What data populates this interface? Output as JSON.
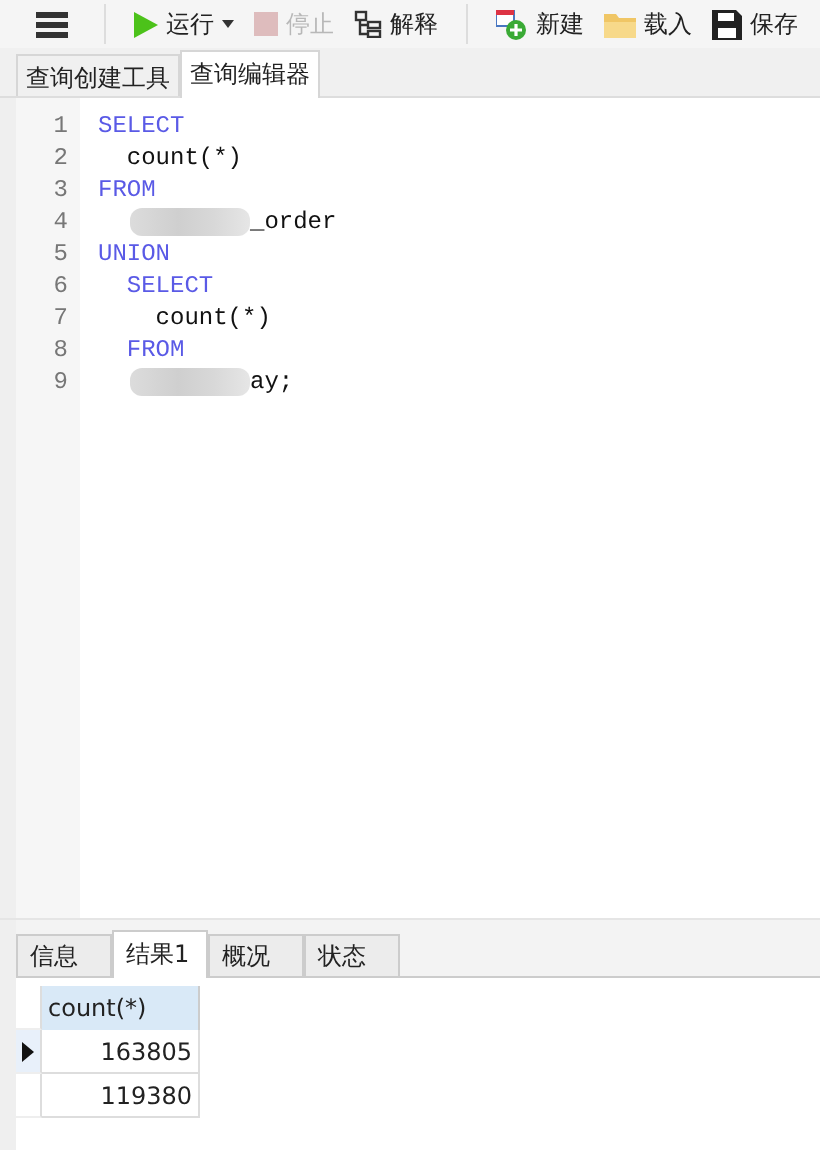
{
  "toolbar": [
    {
      "kind": "menu"
    },
    {
      "kind": "run",
      "label": "运行",
      "disabled": false
    },
    {
      "kind": "stop",
      "label": "停止",
      "disabled": true
    },
    {
      "kind": "explain",
      "label": "解释",
      "disabled": false
    },
    {
      "kind": "new",
      "label": "新建",
      "disabled": false
    },
    {
      "kind": "load",
      "label": "载入",
      "disabled": false
    },
    {
      "kind": "save",
      "label": "保存",
      "disabled": false
    }
  ],
  "editor_tabs": [
    {
      "label": "查询创建工具",
      "selected": false
    },
    {
      "label": "查询编辑器",
      "selected": true
    }
  ],
  "code_lines": [
    {
      "number": "1",
      "text": "SELECT",
      "kind": "keyword",
      "redacted": false
    },
    {
      "number": "2",
      "text": "  count(*)",
      "kind": "plain",
      "redacted": false
    },
    {
      "number": "3",
      "text": "FROM",
      "kind": "keyword",
      "redacted": false
    },
    {
      "number": "4",
      "text": "_order",
      "kind": "plain",
      "redacted": true
    },
    {
      "number": "5",
      "text": "UNION",
      "kind": "keyword",
      "redacted": false
    },
    {
      "number": "6",
      "text": "  SELECT",
      "kind": "keyword",
      "redacted": false
    },
    {
      "number": "7",
      "text": "    count(*)",
      "kind": "plain",
      "redacted": false
    },
    {
      "number": "8",
      "text": "  FROM",
      "kind": "keyword",
      "redacted": false
    },
    {
      "number": "9",
      "text": "ay;",
      "kind": "plain",
      "redacted": true
    }
  ],
  "result_tabs": [
    {
      "label": "信息",
      "selected": false
    },
    {
      "label": "结果1",
      "selected": true
    },
    {
      "label": "概况",
      "selected": false
    },
    {
      "label": "状态",
      "selected": false
    }
  ],
  "result_table": {
    "columns": [
      "count(*)"
    ],
    "rows": [
      {
        "cells": [
          "163805"
        ],
        "current": true
      },
      {
        "cells": [
          "119380"
        ],
        "current": false
      }
    ]
  }
}
